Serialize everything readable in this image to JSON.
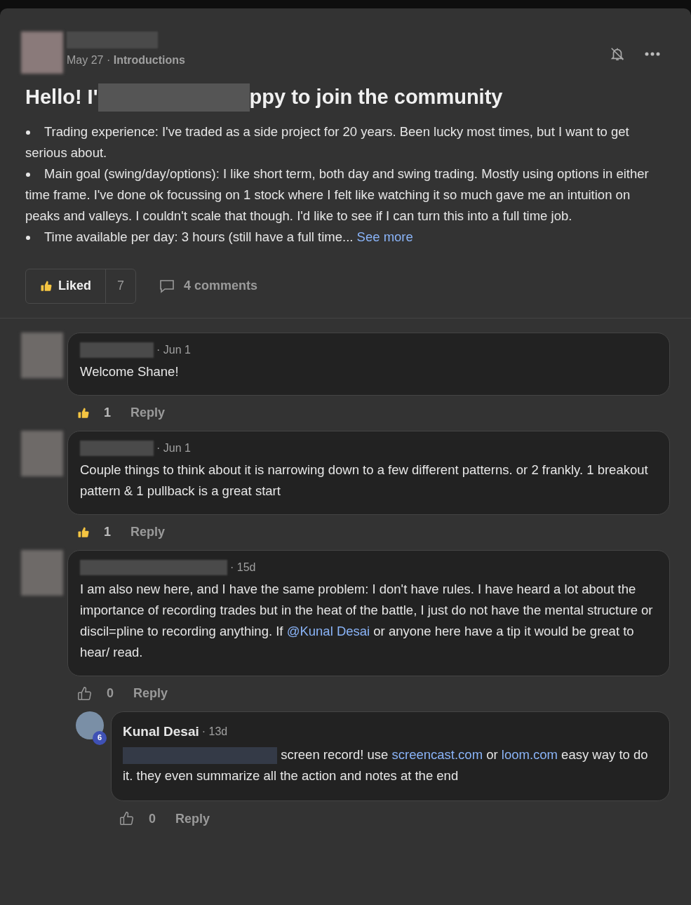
{
  "separator": "·",
  "post": {
    "date": "May 27",
    "category": "Introductions",
    "title_start": "Hello! I'",
    "title_end": "ppy to join the community",
    "bullets": [
      {
        "text": "Trading experience: I've traded as a side project for 20 years. Been lucky most times, but I want to get serious about."
      },
      {
        "text": "Main goal (swing/day/options): I like short term, both day and swing trading. Mostly using options in either time frame. I've done ok focussing on 1 stock where I felt like watching it so much gave me an intuition on peaks and valleys. I couldn't scale that though. I'd like to see if I can turn this into a full time job."
      },
      {
        "text": "Time available per day: 3 hours (still have a full time...",
        "link": "See more"
      }
    ],
    "like": {
      "label": "Liked",
      "count": "7",
      "selected": true
    },
    "comments_label": "4 comments"
  },
  "comments": [
    {
      "date": "Jun 1",
      "liked": true,
      "likes": "1",
      "reply": "Reply",
      "segments": [
        {
          "kind": "text",
          "text": "Welcome Shane!"
        }
      ]
    },
    {
      "date": "Jun 1",
      "liked": true,
      "likes": "1",
      "reply": "Reply",
      "segments": [
        {
          "kind": "text",
          "text": "Couple things to think about it is narrowing down to a few different patterns. or 2 frankly. 1 breakout pattern & 1 pullback is a great start"
        }
      ]
    },
    {
      "date": "15d",
      "liked": false,
      "likes": "0",
      "reply": "Reply",
      "segments": [
        {
          "kind": "text",
          "text": "I am also new here, and I have the same problem: I don't have rules. I have heard a lot about the importance of recording trades but in the heat of the battle, I just do not have the mental structure or discil=pline to recording anything. If "
        },
        {
          "kind": "link",
          "text": "@Kunal Desai"
        },
        {
          "kind": "text",
          "text": " or anyone here have a tip it would be great to hear/ read."
        }
      ],
      "replies": [
        {
          "author": "Kunal Desai",
          "badge": "6",
          "date": "13d",
          "liked": false,
          "likes": "0",
          "reply": "Reply",
          "segments": [
            {
              "kind": "redacted"
            },
            {
              "kind": "text",
              "text": " screen record! use "
            },
            {
              "kind": "link",
              "text": "screencast.com"
            },
            {
              "kind": "text",
              "text": " or "
            },
            {
              "kind": "link",
              "text": "loom.com"
            },
            {
              "kind": "text",
              "text": " easy way to do it. they even summarize all the action and notes at the end"
            }
          ]
        }
      ]
    }
  ]
}
